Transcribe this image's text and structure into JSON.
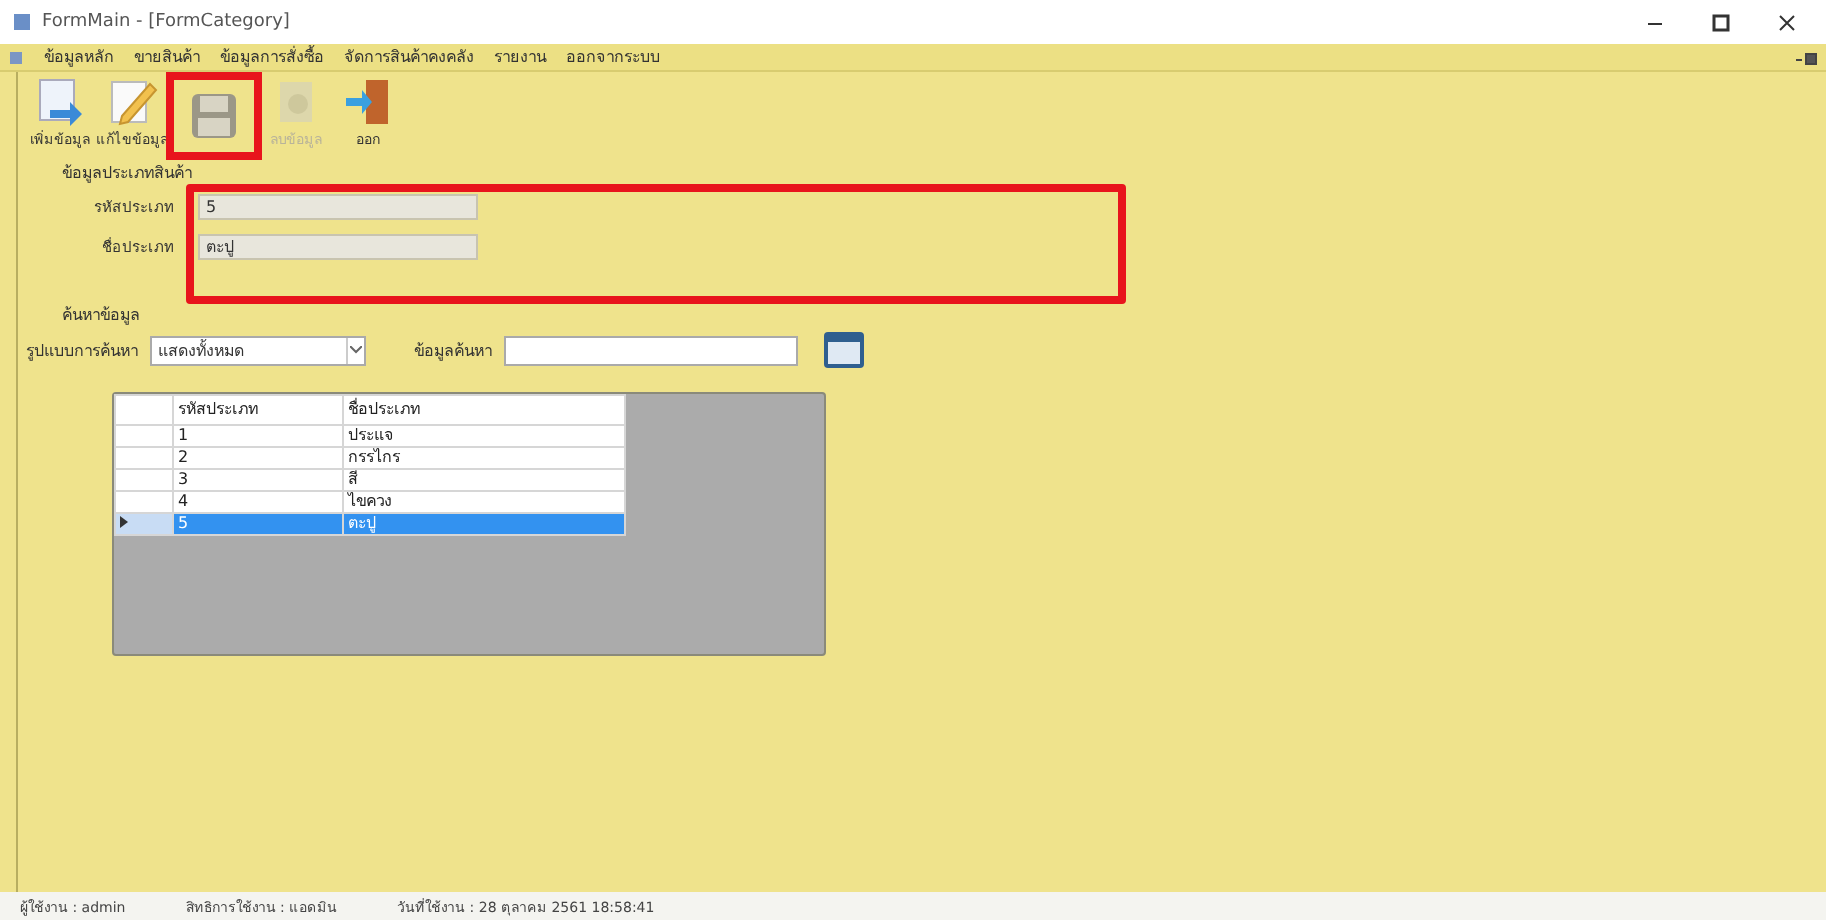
{
  "window": {
    "title": "FormMain - [FormCategory]"
  },
  "menu": [
    "ข้อมูลหลัก",
    "ขายสินค้า",
    "ข้อมูลการสั่งซื้อ",
    "จัดการสินค้าคงคลัง",
    "รายงาน",
    "ออกจากระบบ"
  ],
  "toolbar": [
    {
      "kind": "add",
      "label": "เพิ่มข้อมูล",
      "disabled": false
    },
    {
      "kind": "edit",
      "label": "แก้ไขข้อมูล",
      "disabled": false
    },
    {
      "kind": "save",
      "disabled": false
    },
    {
      "kind": "delete",
      "label": "ลบข้อมูล",
      "disabled": true
    },
    {
      "kind": "exit",
      "label": "ออก",
      "disabled": false
    }
  ],
  "details": {
    "title": "ข้อมูลประเภทสินค้า",
    "fields": [
      {
        "label": "รหัสประเภท",
        "value": "5"
      },
      {
        "label": "ชื่อประเภท",
        "value": "ตะปู"
      }
    ]
  },
  "search": {
    "title": "ค้นหาข้อมูล",
    "mode_label": "รูปแบบการค้นหา",
    "mode_value": "แสดงทั้งหมด",
    "keyword_label": "ข้อมูลค้นหา"
  },
  "table": {
    "columns": [
      "รหัสประเภท",
      "ชื่อประเภท"
    ],
    "rows": [
      {
        "cells": [
          "1",
          "ประแจ"
        ],
        "selected": false
      },
      {
        "cells": [
          "2",
          "กรรไกร"
        ],
        "selected": false
      },
      {
        "cells": [
          "3",
          "สี"
        ],
        "selected": false
      },
      {
        "cells": [
          "4",
          "ไขควง"
        ],
        "selected": false
      },
      {
        "cells": [
          "5",
          "ตะปู"
        ],
        "selected": true
      }
    ]
  },
  "status_bar": [
    "ผู้ใช้งาน : admin",
    "สิทธิการใช้งาน : แอดมิน",
    "วันที่ใช้งาน : 28 ตุลาคม 2561 18:58:41"
  ]
}
